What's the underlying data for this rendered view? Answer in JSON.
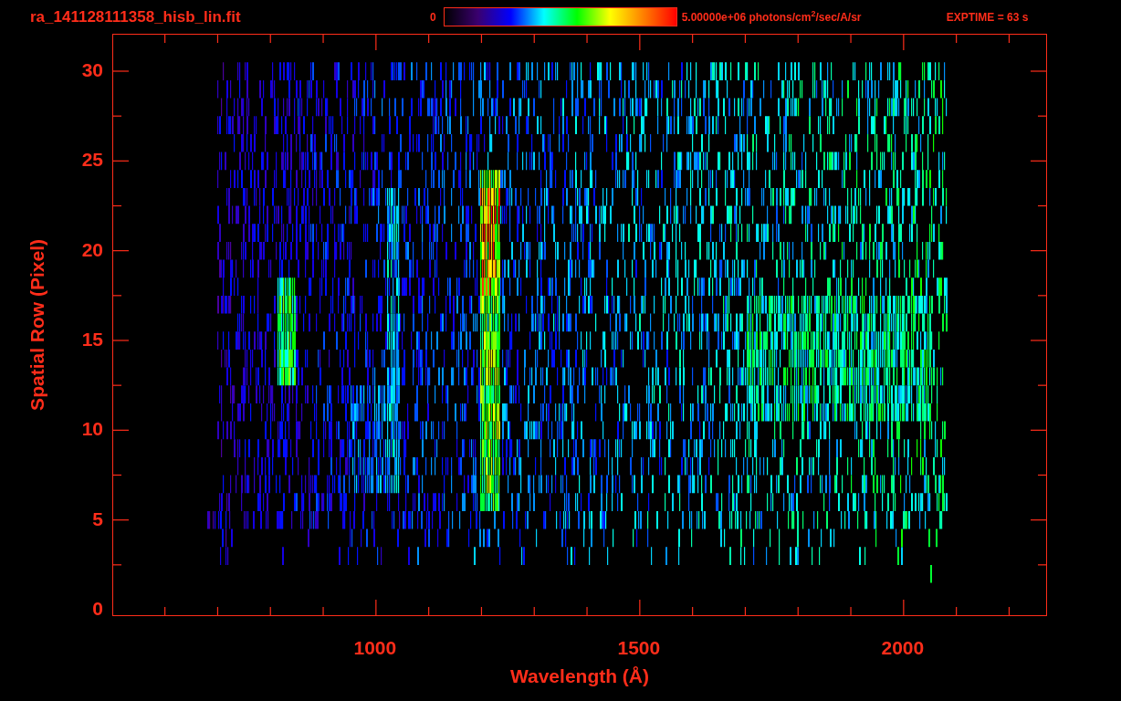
{
  "title": "ra_141128111358_hisb_lin.fit",
  "colorbar": {
    "min_label": "0",
    "max_label": "5.00000e+06 photons/cm$^{2}$/sec/A/sr"
  },
  "exptime": "EXPTIME = 63 s",
  "plot": {
    "xlabel": "Wavelength (Å)",
    "ylabel": "Spatial Row (Pixel)",
    "xticks": [
      "1000",
      "1500",
      "2000"
    ],
    "yticks": [
      "30",
      "25",
      "20",
      "15",
      "10",
      "5",
      "0"
    ]
  }
}
